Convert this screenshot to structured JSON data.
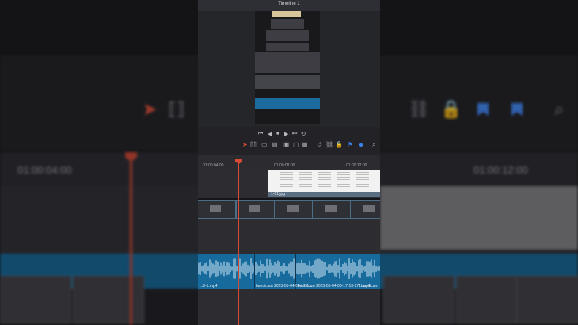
{
  "viewer": {
    "title": "Timeline 1"
  },
  "ruler": {
    "tc1": "01:00:04:00",
    "tc2": "01:00:08:00",
    "tc3": "01:00:12:00"
  },
  "clips": {
    "image_clip_name": "1-01.jpg",
    "audio_names": [
      "...9-1.mp4",
      "bandicam 2023-05-04 06-17-1...",
      "bandicam 2023-05-04 06-17-13-271.mp4",
      "bandicam"
    ]
  },
  "background": {
    "tc_left": "01:00:04:00",
    "tc_right": "01:00:12:00"
  },
  "colors": {
    "playhead": "#d84a33",
    "audio": "#176a9c",
    "marker": "#3b7fe8"
  },
  "icons": [
    "prev-icon",
    "stop-icon",
    "play-icon",
    "next-icon",
    "loop-icon",
    "select-icon",
    "trim-icon",
    "link-icon",
    "lock-icon",
    "flag-icon",
    "marker-icon",
    "zoom-icon"
  ]
}
